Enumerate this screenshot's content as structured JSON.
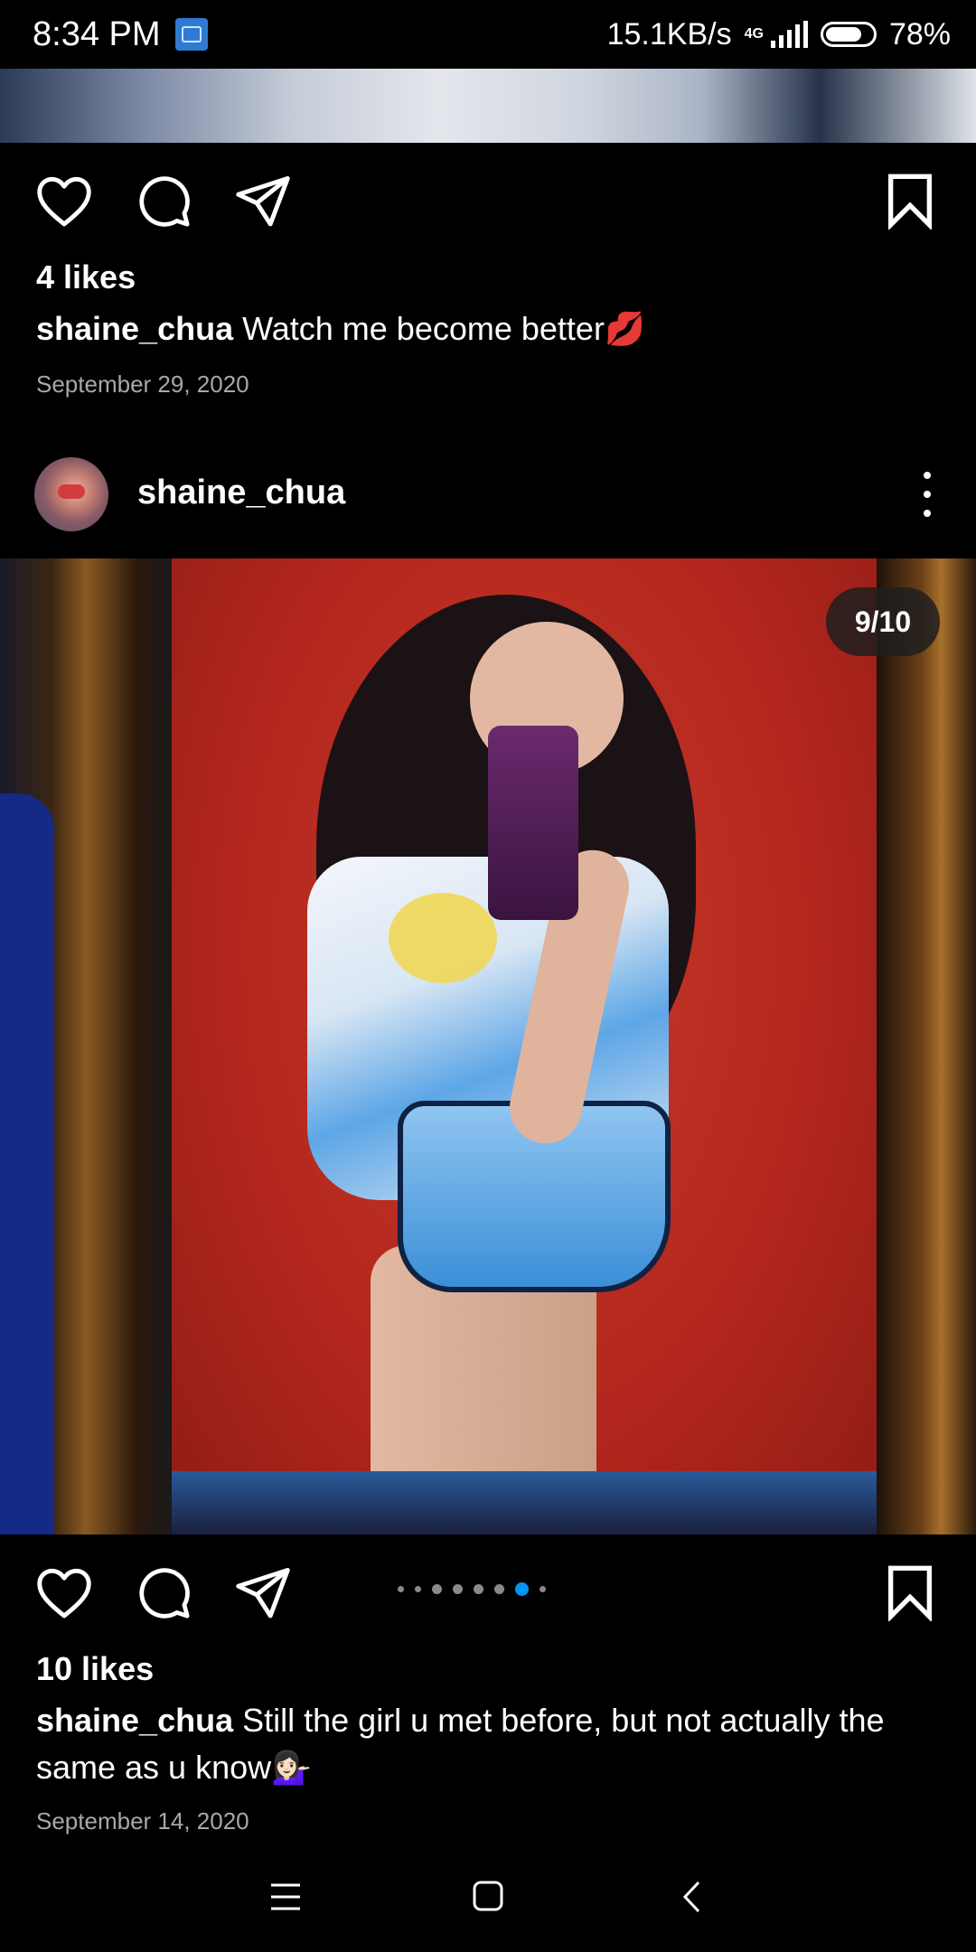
{
  "status_bar": {
    "time": "8:34 PM",
    "network_speed": "15.1KB/s",
    "network_type": "4G",
    "battery": "78%"
  },
  "post_1": {
    "likes": "4 likes",
    "username": "shaine_chua",
    "caption": "Watch me become better💋",
    "date": "September 29, 2020"
  },
  "post_2": {
    "username": "shaine_chua",
    "image_counter": "9/10",
    "likes": "10 likes",
    "caption": "Still the girl u met before, but not actually the same as u know💁🏻‍♀️",
    "date": "September 14, 2020",
    "carousel_current": 9,
    "carousel_total": 10
  },
  "colors": {
    "background": "#000000",
    "text": "#ffffff",
    "secondary_text": "#a8a8a8",
    "active_dot": "#0095f6"
  },
  "icons": [
    "heart-icon",
    "comment-icon",
    "share-icon",
    "bookmark-icon",
    "more-icon",
    "menu-icon",
    "home-icon",
    "back-icon"
  ]
}
